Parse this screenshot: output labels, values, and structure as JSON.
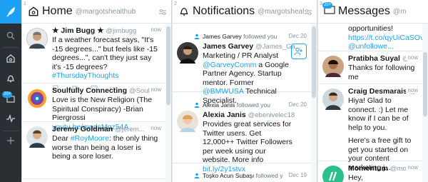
{
  "sidebar": {
    "dm_badge": "20+"
  },
  "home": {
    "number": "1",
    "title": "Home",
    "account": "@margotshealthub",
    "tweets": [
      {
        "name": "★ Jim Bugg ★",
        "handle": "@jimbugg",
        "time": "now",
        "text": "If a weather forecast says, \"It's -15 degrees...\" but feels like -15 degrees...\", can't they just say it's -15 degrees? ",
        "link": "#ThursdayThoughts"
      },
      {
        "name": "Soulfully Connecting",
        "handle": "@Soul...",
        "time": "now",
        "text": "Love is the New Religion (The Spiritual Conspiracy) -Brian Piergrossi ",
        "link": "youtu.be/mndsMqz54A"
      },
      {
        "name": "Jeremy Goldman",
        "handle": "@jerem...",
        "time": "now",
        "text_pre": "Dear ",
        "link": "#RoyMoore",
        "text": ": the only thing worse than being a loser is being a sore loser."
      }
    ]
  },
  "notifications": {
    "number": "2",
    "title": "Notifications",
    "account": "@margotsheal...",
    "items": [
      {
        "who": "James Garvey",
        "action": " followed you",
        "time": "Dec 20",
        "name": "James Garvey",
        "handle": "@James_Ga...",
        "bio_pre": "Marketing / PR Analyst ",
        "bio_link1": "@GarveyComm",
        "bio_mid": " a Google Partner Agency. Startup mentor. Former ",
        "bio_link2": "@BMWUSA",
        "bio_post": " Technical Specialist."
      },
      {
        "who": "Alexia Janis",
        "action": " followed you",
        "time": "Dec 20",
        "name": "Alexia Janis",
        "handle": "@ebenivelec18",
        "bio_pre": "Provides great services for Twitter users. Get 12,000++ Twitter Followers per week using our website. More info ",
        "bio_link1": "bit.ly/2y1stvx"
      },
      {
        "who": "Toşko Acun Subaşı",
        "action": " followed you",
        "time": "Dec 19"
      }
    ]
  },
  "messages": {
    "number": "3",
    "title": "Messages",
    "account": "@m",
    "top_text": "opportunities!",
    "top_link1": "https://t.co/qyUiCaSOvs",
    "top_link2": "@unfollowe...",
    "items": [
      {
        "name": "Pratibha Suyal",
        "handle": "@sfde...",
        "time": "now",
        "text": "Thanks for following me"
      },
      {
        "name": "Craig Desmarais",
        "handle": "@crai...",
        "time": "now",
        "text": "Hiya!  Glad to connect. :) Let me know if I can be of help to you.",
        "text2": "Here's a free gift to get you started on your content marketing j..."
      },
      {
        "name": "Momentum",
        "handle": "@moment...",
        "time": "now",
        "text": "Hey,"
      }
    ]
  },
  "colors": {
    "accent": "#1da1f2",
    "sidebar_bg": "#292f33"
  }
}
